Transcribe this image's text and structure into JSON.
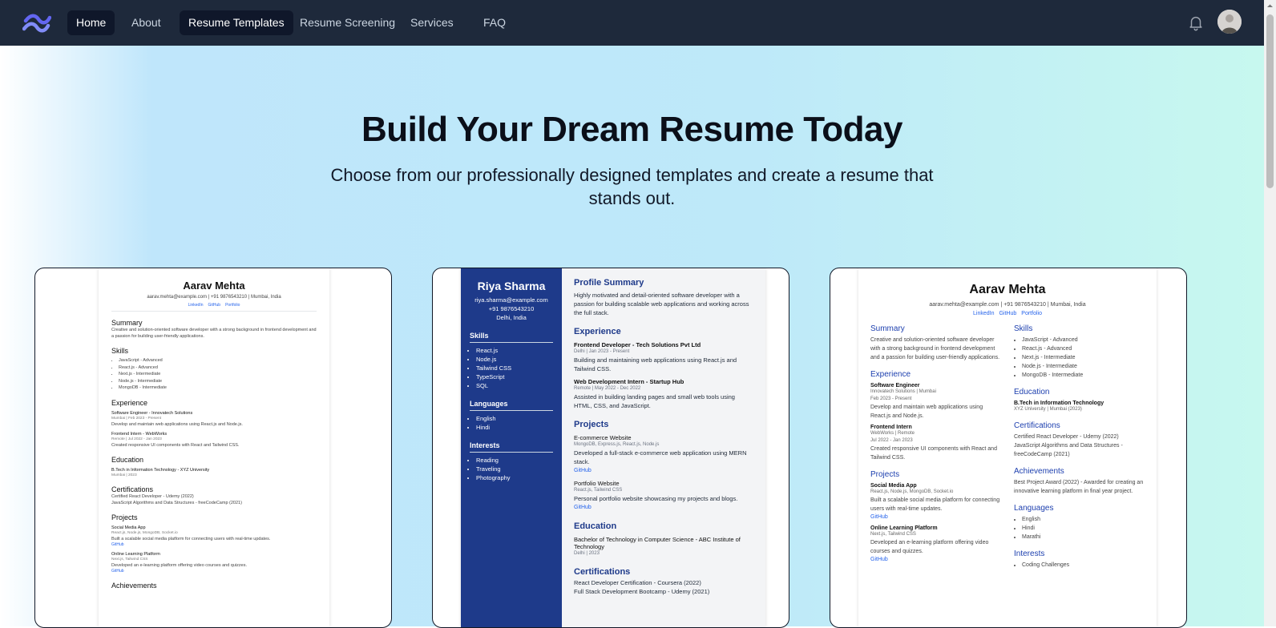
{
  "nav": {
    "items": [
      {
        "label": "Home"
      },
      {
        "label": "About"
      },
      {
        "label": "Resume Templates"
      },
      {
        "label": "Resume Screening"
      },
      {
        "label": "Services"
      },
      {
        "label": "FAQ"
      }
    ]
  },
  "hero": {
    "title": "Build Your Dream Resume Today",
    "subtitle": "Choose from our professionally designed templates and create a resume that stands out."
  },
  "template1": {
    "name": "Aarav Mehta",
    "contact": "aarav.mehta@example.com | +91 9876543210 | Mumbai, India",
    "links": [
      "LinkedIn",
      "GitHub",
      "Portfolio"
    ],
    "summary_title": "Summary",
    "summary": "Creative and solution-oriented software developer with a strong background in frontend development and a passion for building user-friendly applications.",
    "skills_title": "Skills",
    "skills": [
      "JavaScript - Advanced",
      "React.js - Advanced",
      "Next.js - Intermediate",
      "Node.js - Intermediate",
      "MongoDB - Intermediate"
    ],
    "experience_title": "Experience",
    "exp1_title": "Software Engineer - Innovatech Solutions",
    "exp1_meta": "Mumbai | Feb 2023 - Present",
    "exp1_desc": "Develop and maintain web applications using React.js and Node.js.",
    "exp2_title": "Frontend Intern - WebWorks",
    "exp2_meta": "Remote | Jul 2022 - Jan 2023",
    "exp2_desc": "Created responsive UI components with React and Tailwind CSS.",
    "education_title": "Education",
    "edu1": "B.Tech in Information Technology - XYZ University",
    "edu1_meta": "Mumbai | 2023",
    "cert_title": "Certifications",
    "cert1": "Certified React Developer - Udemy (2022)",
    "cert2": "JavaScript Algorithms and Data Structures - freeCodeCamp (2021)",
    "projects_title": "Projects",
    "proj1_title": "Social Media App",
    "proj1_meta": "React.js, Node.js, MongoDB, Socket.io",
    "proj1_desc": "Built a scalable social media platform for connecting users with real-time updates.",
    "proj1_link": "GitHub",
    "proj2_title": "Online Learning Platform",
    "proj2_meta": "Next.js, Tailwind CSS",
    "proj2_desc": "Developed an e-learning platform offering video courses and quizzes.",
    "proj2_link": "GitHub",
    "achievements_title": "Achievements"
  },
  "template2": {
    "name": "Riya Sharma",
    "email": "riya.sharma@example.com",
    "phone": "+91 9876543210",
    "location": "Delhi, India",
    "skills_title": "Skills",
    "skills": [
      "React.js",
      "Node.js",
      "Tailwind CSS",
      "TypeScript",
      "SQL"
    ],
    "languages_title": "Languages",
    "languages": [
      "English",
      "Hindi"
    ],
    "interests_title": "Interests",
    "interests": [
      "Reading",
      "Traveling",
      "Photography"
    ],
    "profile_title": "Profile Summary",
    "profile": "Highly motivated and detail-oriented software developer with a passion for building scalable web applications and working across the full stack.",
    "experience_title": "Experience",
    "exp1_title": "Frontend Developer - Tech Solutions Pvt Ltd",
    "exp1_meta": "Delhi | Jan 2023 - Present",
    "exp1_desc": "Building and maintaining web applications using React.js and Tailwind CSS.",
    "exp2_title": "Web Development Intern - Startup Hub",
    "exp2_meta": "Remote | May 2022 - Dec 2022",
    "exp2_desc": "Assisted in building landing pages and small web tools using HTML, CSS, and JavaScript.",
    "projects_title": "Projects",
    "proj1_title": "E-commerce Website",
    "proj1_meta": "MongoDB, Express.js, React.js, Node.js",
    "proj1_desc": "Developed a full-stack e-commerce web application using MERN stack.",
    "proj1_link": "GitHub",
    "proj2_title": "Portfolio Website",
    "proj2_meta": "React.js, Tailwind CSS",
    "proj2_desc": "Personal portfolio website showcasing my projects and blogs.",
    "proj2_link": "GitHub",
    "education_title": "Education",
    "edu1": "Bachelor of Technology in Computer Science - ABC Institute of Technology",
    "edu1_meta": "Delhi | 2023",
    "cert_title": "Certifications",
    "cert1": "React Developer Certification - Coursera (2022)",
    "cert2": "Full Stack Development Bootcamp - Udemy (2021)"
  },
  "template3": {
    "name": "Aarav Mehta",
    "contact": "aarav.mehta@example.com | +91 9876543210 | Mumbai, India",
    "links": [
      "LinkedIn",
      "GitHub",
      "Portfolio"
    ],
    "summary_title": "Summary",
    "summary": "Creative and solution-oriented software developer with a strong background in frontend development and a passion for building user-friendly applications.",
    "experience_title": "Experience",
    "exp1_title": "Software Engineer",
    "exp1_meta": "Innovatech Solutions | Mumbai",
    "exp1_date": "Feb 2023 - Present",
    "exp1_desc": "Develop and maintain web applications using React.js and Node.js.",
    "exp2_title": "Frontend Intern",
    "exp2_meta": "WebWorks | Remote",
    "exp2_date": "Jul 2022 - Jan 2023",
    "exp2_desc": "Created responsive UI components with React and Tailwind CSS.",
    "projects_title": "Projects",
    "proj1_title": "Social Media App",
    "proj1_meta": "React.js, Node.js, MongoDB, Socket.io",
    "proj1_desc": "Built a scalable social media platform for connecting users with real-time updates.",
    "proj1_link": "GitHub",
    "proj2_title": "Online Learning Platform",
    "proj2_meta": "Next.js, Tailwind CSS",
    "proj2_desc": "Developed an e-learning platform offering video courses and quizzes.",
    "proj2_link": "GitHub",
    "skills_title": "Skills",
    "skills": [
      "JavaScript - Advanced",
      "React.js - Advanced",
      "Next.js - Intermediate",
      "Node.js - Intermediate",
      "MongoDB - Intermediate"
    ],
    "education_title": "Education",
    "edu1": "B.Tech in Information Technology",
    "edu1_meta": "XYZ University | Mumbai (2023)",
    "cert_title": "Certifications",
    "cert1": "Certified React Developer - Udemy (2022)",
    "cert2": "JavaScript Algorithms and Data Structures - freeCodeCamp (2021)",
    "achievements_title": "Achievements",
    "achievement1": "Best Project Award (2022) - Awarded for creating an innovative learning platform in final year project.",
    "languages_title": "Languages",
    "languages": [
      "English",
      "Hindi",
      "Marathi"
    ],
    "interests_title": "Interests",
    "interests": [
      "Coding Challenges"
    ]
  },
  "icons": {
    "logo": "wave-logo-icon",
    "bell": "bell-icon",
    "avatar": "user-avatar"
  },
  "colors": {
    "nav_bg": "#1e293b",
    "accent_blue": "#1e3a8a",
    "link_blue": "#2563eb"
  }
}
